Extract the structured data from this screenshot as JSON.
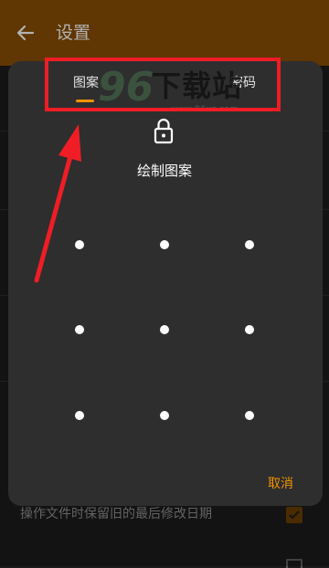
{
  "appbar": {
    "title": "设置",
    "back_icon": "arrow-left-icon",
    "color": "#8a4e04"
  },
  "background": {
    "setting_label": "操作文件时保留旧的最后修改日期",
    "setting_checked": true
  },
  "dialog": {
    "tabs": [
      {
        "label": "图案",
        "selected": true
      },
      {
        "label": "密码",
        "selected": false
      }
    ],
    "lock_icon": "lock-icon",
    "prompt": "绘制图案",
    "pattern_grid": {
      "rows": 3,
      "cols": 3
    },
    "cancel_label": "取消",
    "accent_color": "#f19300"
  },
  "watermark": {
    "digits": "96",
    "text": "下载站",
    "url": "www.96xz.com"
  },
  "annotation": {
    "box_color": "#ef1d25",
    "arrow_color": "#ef1d25"
  }
}
